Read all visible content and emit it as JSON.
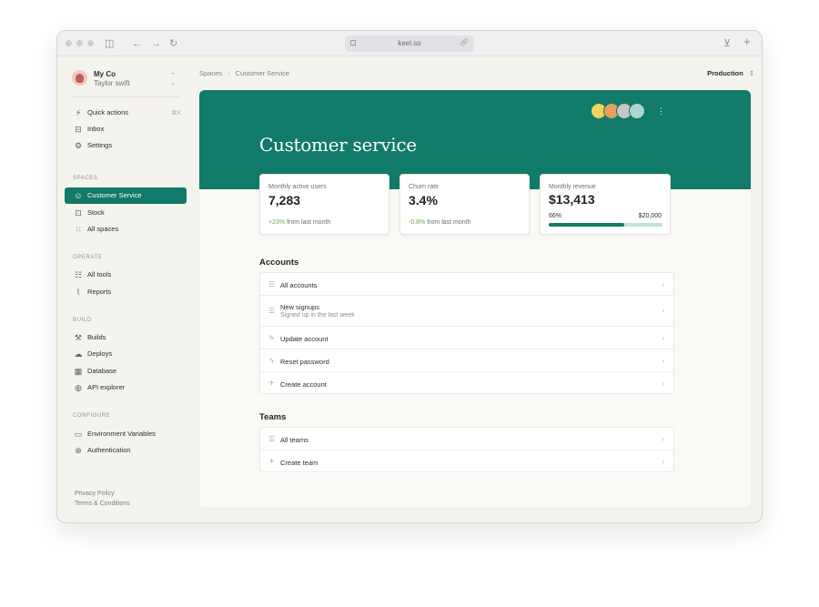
{
  "browser": {
    "url": "keel.so"
  },
  "sidebar": {
    "org_name": "My Co",
    "user_name": "Taylor swift",
    "top_items": [
      {
        "label": "Quick actions",
        "shortcut": "⌘K"
      },
      {
        "label": "Inbox"
      },
      {
        "label": "Settings"
      }
    ],
    "sections": {
      "spaces": "SPACES",
      "operate": "OPERATE",
      "build": "BUILD",
      "configure": "CONFIGURE"
    },
    "spaces_items": [
      {
        "label": "Customer Service"
      },
      {
        "label": "Stock"
      },
      {
        "label": "All spaces"
      }
    ],
    "operate_items": [
      {
        "label": "All tools"
      },
      {
        "label": "Reports"
      }
    ],
    "build_items": [
      {
        "label": "Builds"
      },
      {
        "label": "Deploys"
      },
      {
        "label": "Database"
      },
      {
        "label": "API explorer"
      }
    ],
    "configure_items": [
      {
        "label": "Environment Variables"
      },
      {
        "label": "Authentication"
      }
    ],
    "footer": {
      "privacy": "Privacy Policy",
      "terms": "Terms & Conditions"
    }
  },
  "header": {
    "breadcrumb": [
      "Spaces",
      "Customer Service"
    ],
    "environment": "Production"
  },
  "hero": {
    "title": "Customer service"
  },
  "stats": [
    {
      "label": "Monthly active users",
      "value": "7,283",
      "delta": "+23%",
      "delta_suffix": "from last month"
    },
    {
      "label": "Churn rate",
      "value": "3.4%",
      "delta": "-0.8%",
      "delta_suffix": "from last month"
    },
    {
      "label": "Monthly revenue",
      "value": "$13,413",
      "progress_label": "66%",
      "goal": "$20,000",
      "progress": 0.66
    }
  ],
  "accounts": {
    "heading": "Accounts",
    "rows": [
      {
        "label": "All accounts"
      },
      {
        "label": "New signups",
        "sub": "Signed up in the last week"
      },
      {
        "label": "Update account"
      },
      {
        "label": "Reset password"
      },
      {
        "label": "Create account"
      }
    ]
  },
  "teams": {
    "heading": "Teams",
    "rows": [
      {
        "label": "All teams"
      },
      {
        "label": "Create team"
      }
    ]
  },
  "colors": {
    "brand": "#127a68",
    "positive": "#6ea64a"
  }
}
